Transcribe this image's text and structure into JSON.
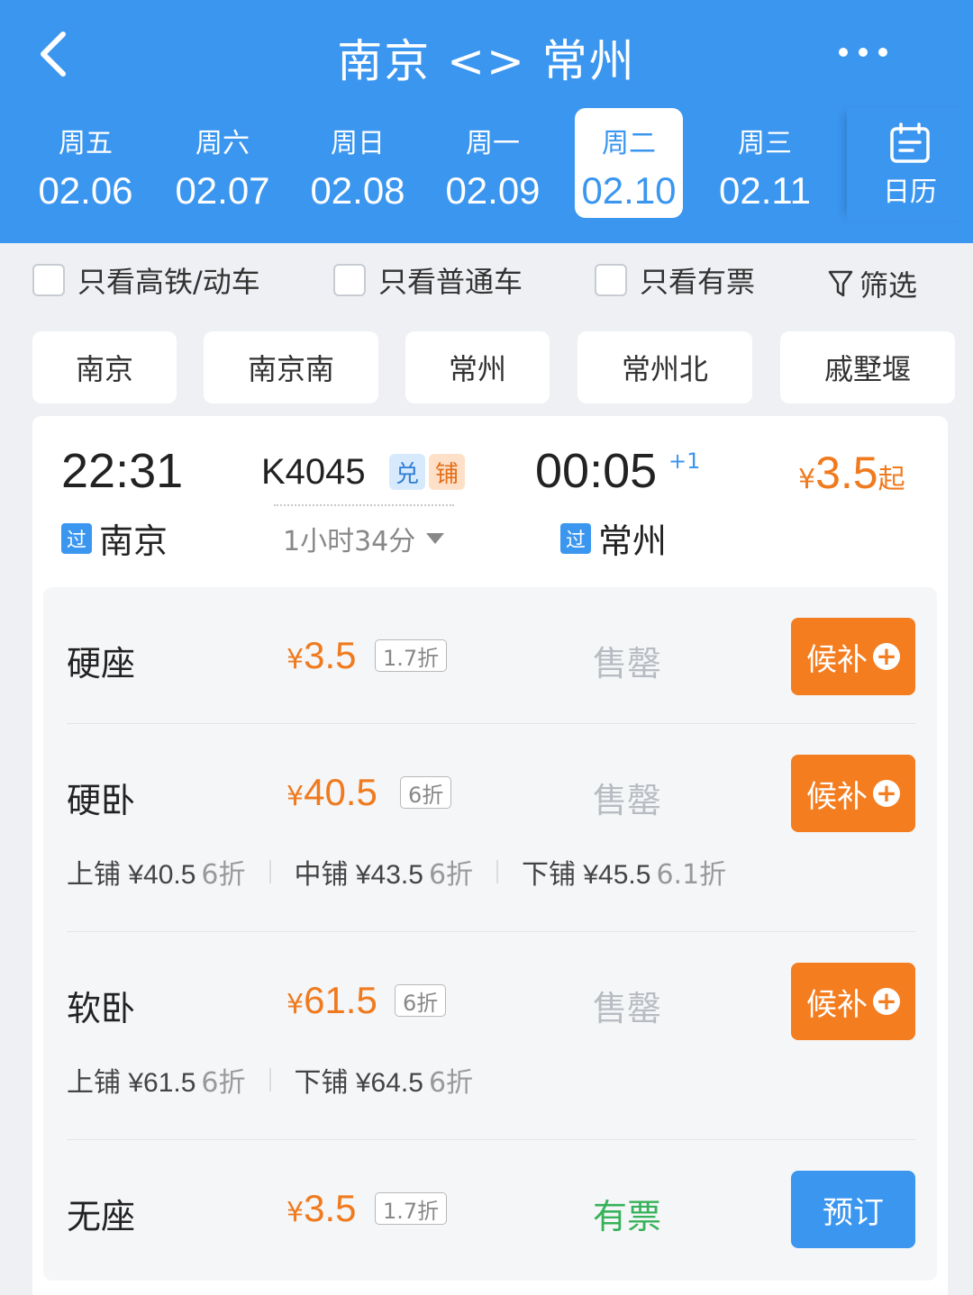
{
  "header": {
    "title": "南京 <> 常州",
    "back_icon": "chevron-left-icon",
    "more_icon": "more-horizontal-icon",
    "dates": [
      {
        "weekday": "周五",
        "date": "02.06"
      },
      {
        "weekday": "周六",
        "date": "02.07"
      },
      {
        "weekday": "周日",
        "date": "02.08"
      },
      {
        "weekday": "周一",
        "date": "02.09"
      },
      {
        "weekday": "周二",
        "date": "02.10",
        "selected": true
      },
      {
        "weekday": "周三",
        "date": "02.11"
      }
    ],
    "calendar_label": "日历",
    "colors": {
      "header_bg": "#3b96f0",
      "text": "#ffffff"
    }
  },
  "filters": {
    "high_speed": "只看高铁/动车",
    "normal": "只看普通车",
    "available": "只看有票",
    "filter_label": "筛选"
  },
  "stations": [
    "南京",
    "南京南",
    "常州",
    "常州北",
    "戚墅堰"
  ],
  "train": {
    "dep_time": "22:31",
    "dep_station": "南京",
    "pass_label": "过",
    "train_no": "K4045",
    "tags": [
      "兑",
      "铺"
    ],
    "duration": "1小时34分",
    "arr_time": "00:05",
    "next_day": "+1",
    "arr_station": "常州",
    "price_yen": "¥",
    "price_from": "3.5",
    "price_suffix": "起",
    "seats": [
      {
        "name": "硬座",
        "yen": "¥",
        "price": "3.5",
        "discount": "1.7折",
        "status": "售罄",
        "action": "候补"
      },
      {
        "name": "硬卧",
        "yen": "¥",
        "price": "40.5",
        "discount": "6折",
        "status": "售罄",
        "action": "候补",
        "berths": [
          {
            "label": "上铺 ¥40.5",
            "discount": "6折"
          },
          {
            "label": "中铺 ¥43.5",
            "discount": "6折"
          },
          {
            "label": "下铺 ¥45.5",
            "discount": "6.1折"
          }
        ]
      },
      {
        "name": "软卧",
        "yen": "¥",
        "price": "61.5",
        "discount": "6折",
        "status": "售罄",
        "action": "候补",
        "berths": [
          {
            "label": "上铺 ¥61.5",
            "discount": "6折"
          },
          {
            "label": "下铺 ¥64.5",
            "discount": "6折"
          }
        ]
      },
      {
        "name": "无座",
        "yen": "¥",
        "price": "3.5",
        "discount": "1.7折",
        "status": "有票",
        "action": "预订"
      }
    ],
    "colors": {
      "price": "#f07a1e",
      "wait_button": "#f47d20",
      "book_button": "#3b96f0",
      "available": "#36b25a",
      "sold_out": "#b8bcc2"
    }
  }
}
